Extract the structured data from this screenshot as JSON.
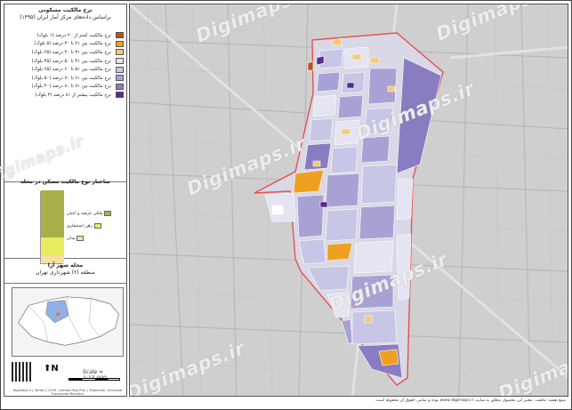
{
  "legend": {
    "title_line1": "نرخ مالکیت مسکونی",
    "title_line2": "براساس داده‌های مرکز آمار ایران (۱۳۹۵)",
    "items": [
      {
        "label": "نرخ مالکیت کمتر از ۲۰ درصد (۱ بلوک)",
        "color": "#b5541c"
      },
      {
        "label": "نرخ مالکیت بین ۲۱ تا ۳۰ درصد (۵ بلوک)",
        "color": "#f0a020"
      },
      {
        "label": "نرخ مالکیت بین ۳۱ تا ۴۰ درصد (۲۵ بلوک)",
        "color": "#f6c87a"
      },
      {
        "label": "نرخ مالکیت بین ۴۱ تا ۵۰ درصد (۴۵ بلوک)",
        "color": "#e4e4f2"
      },
      {
        "label": "نرخ مالکیت بین ۵۱ تا ۶۰ درصد (۶۵ بلوک)",
        "color": "#c8c6e6"
      },
      {
        "label": "نرخ مالکیت بین ۶۱ تا ۷۰ درصد (۵۰ بلوک)",
        "color": "#a8a2d4"
      },
      {
        "label": "نرخ مالکیت بین ۷۱ تا ۸۰ درصد (۴۰ بلوک)",
        "color": "#8a7cc0"
      },
      {
        "label": "نرخ مالکیت بیشتر از ۸۱ درصد (۳ بلوک)",
        "color": "#5a2a8c"
      }
    ]
  },
  "tenure_chart": {
    "title": "ساختار نوع مالکیت مسکن در محله",
    "segments": [
      {
        "label": "ملکی عرصه و اعیان",
        "color": "#a8b04a",
        "share": 0.65
      },
      {
        "label": "رهن استیجاری",
        "color": "#e8ec60",
        "share": 0.25
      },
      {
        "label": "سایر",
        "color": "#f6e1a4",
        "share": 0.1
      }
    ]
  },
  "location": {
    "neighborhood": "محله شهر آرا",
    "district": "منطقه (۲) شهرداری تهران"
  },
  "scale": "Scale = 1:13,000",
  "credit": "Digimaps.ir | Tehran | 2019 | Iranian Map Pub. | Projection: Universal Transverse Mercator",
  "footer": "منبع نقشه: ماهیت. معتبر این محصول متعلق به سایت www.digimaps.ir بوده و تمامی حقوق آن محفوظ است.",
  "watermark": "Digimaps.ir",
  "watermark_short": "Digimaps.ir",
  "colors": {
    "study_boundary": "#e85050",
    "road": "#a0a0a0",
    "background": "#cfcfcf"
  }
}
